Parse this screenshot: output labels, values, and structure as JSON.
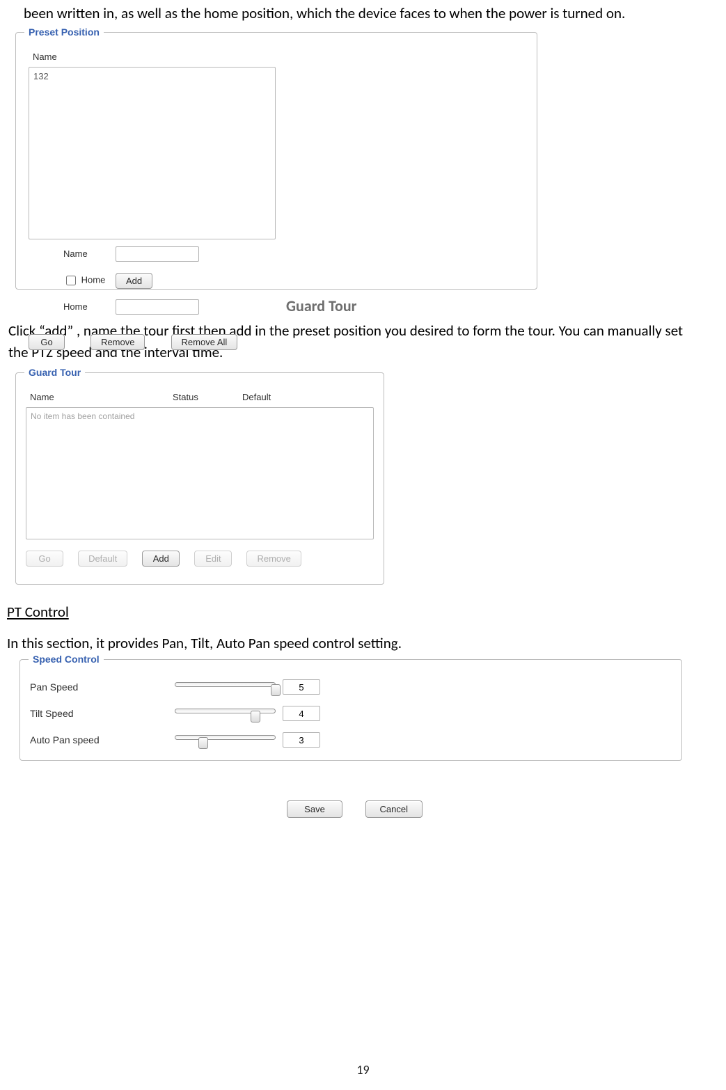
{
  "intro_line": "been written in, as well as the home position, which the device faces to when the power is turned on.",
  "preset_panel": {
    "legend": "Preset Position",
    "list_header": "Name",
    "list_items": [
      "132"
    ],
    "right": {
      "name_label": "Name",
      "name_value": "",
      "home_checkbox_label": "Home",
      "home_checked": false,
      "add_button": "Add",
      "home_label": "Home",
      "home_value": ""
    },
    "actions": {
      "go": "Go",
      "remove": "Remove",
      "remove_all": "Remove All"
    }
  },
  "guard_tour": {
    "heading": "Guard Tour",
    "desc": "Click “add” , name the tour first then add in the preset position you desired to form the tour. You can manually set the PTZ speed and the interval time.",
    "legend": "Guard Tour",
    "columns": {
      "c1": "Name",
      "c2": "Status",
      "c3": "Default"
    },
    "empty_msg": "No item has been contained",
    "actions": {
      "go": "Go",
      "default": "Default",
      "add": "Add",
      "edit": "Edit",
      "remove": "Remove"
    }
  },
  "pt_control": {
    "heading": "PT Control",
    "desc": "In this section, it provides Pan, Tilt, Auto Pan speed control setting."
  },
  "speed_panel": {
    "legend": "Speed Control",
    "rows": [
      {
        "label": "Pan Speed",
        "value": "5",
        "pos_pct": 100
      },
      {
        "label": "Tilt Speed",
        "value": "4",
        "pos_pct": 80
      },
      {
        "label": "Auto Pan speed",
        "value": "3",
        "pos_pct": 28
      }
    ]
  },
  "footer_actions": {
    "save": "Save",
    "cancel": "Cancel"
  },
  "page_number": "19"
}
